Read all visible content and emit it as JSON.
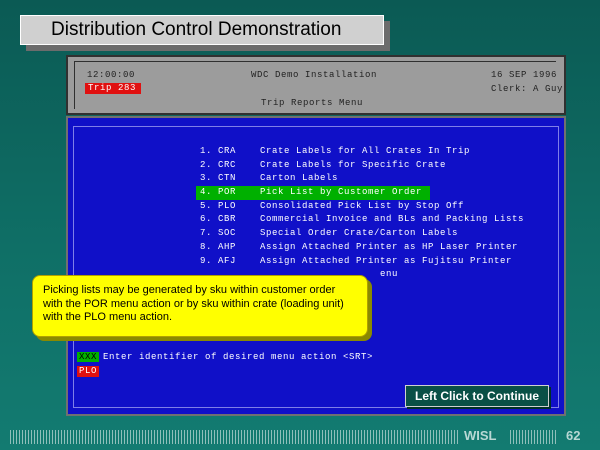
{
  "title": "Distribution Control Demonstration",
  "header": {
    "time": "12:00:00",
    "installation": "WDC Demo Installation",
    "date": "16 SEP 1996",
    "trip_badge": "Trip 283",
    "clerk": "Clerk: A Guy",
    "menu_title": "Trip Reports Menu"
  },
  "menu": [
    {
      "num": "1. CRA",
      "label": "Crate Labels for All Crates In Trip"
    },
    {
      "num": "2. CRC",
      "label": "Crate Labels for Specific Crate"
    },
    {
      "num": "3. CTN",
      "label": "Carton Labels"
    },
    {
      "num": "4. POR",
      "label": "Pick List by Customer Order"
    },
    {
      "num": "5. PLO",
      "label": "Consolidated Pick List by Stop Off"
    },
    {
      "num": "6. CBR",
      "label": "Commercial Invoice and BLs and Packing Lists"
    },
    {
      "num": "7. SOC",
      "label": "Special Order Crate/Carton Labels"
    },
    {
      "num": "8. AHP",
      "label": "Assign Attached Printer as HP Laser Printer"
    },
    {
      "num": "9. AFJ",
      "label": "Assign Attached Printer as Fujitsu Printer"
    },
    {
      "num": "",
      "label": "enu"
    }
  ],
  "prompt": {
    "field": "XXX",
    "text": "Enter identifier of desired menu action <SRT>"
  },
  "plo_tag": "PLO",
  "callout": "Picking lists may be generated by sku within customer order with the POR menu action or by sku within crate (loading unit) with the PLO menu action.",
  "continue_label": "Left Click to Continue",
  "footer": {
    "brand": "WISL",
    "page": "62"
  },
  "colors": {
    "terminal_bg": "#1010c8",
    "highlight": "#00b000",
    "badge_red": "#e01010",
    "callout_yellow": "#ffff00"
  }
}
